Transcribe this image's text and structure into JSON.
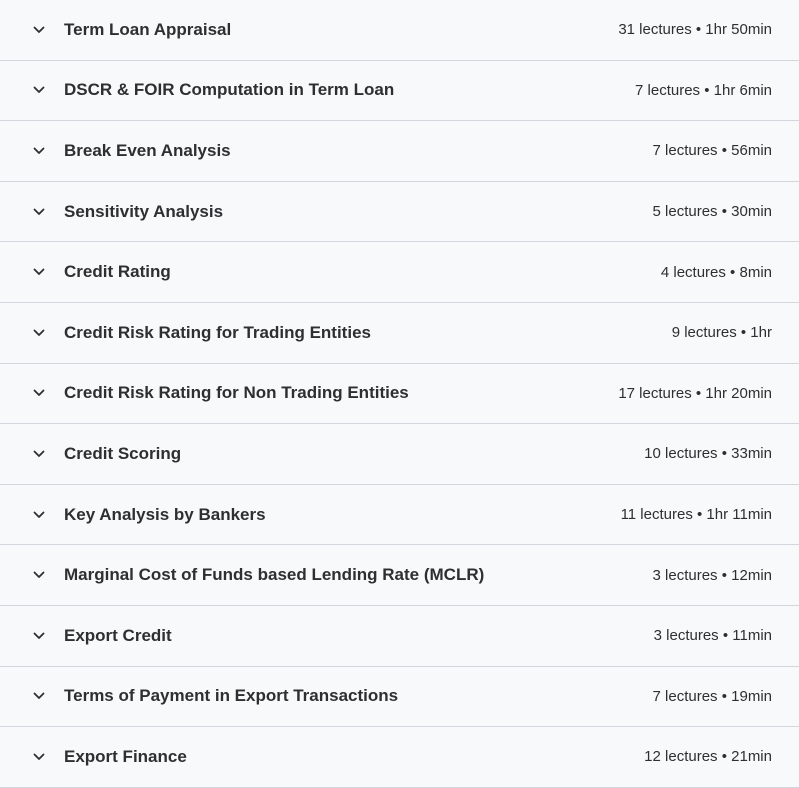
{
  "sections": [
    {
      "title": "Term Loan Appraisal",
      "meta": "31 lectures • 1hr 50min",
      "icon": "chevron-down-icon"
    },
    {
      "title": "DSCR & FOIR Computation in Term Loan",
      "meta": "7 lectures • 1hr 6min",
      "icon": "chevron-down-icon"
    },
    {
      "title": "Break Even Analysis",
      "meta": "7 lectures • 56min",
      "icon": "chevron-down-icon"
    },
    {
      "title": "Sensitivity Analysis",
      "meta": "5 lectures • 30min",
      "icon": "chevron-down-icon"
    },
    {
      "title": "Credit Rating",
      "meta": "4 lectures • 8min",
      "icon": "chevron-down-icon"
    },
    {
      "title": "Credit Risk Rating for Trading Entities",
      "meta": "9 lectures • 1hr",
      "icon": "chevron-down-icon"
    },
    {
      "title": "Credit Risk Rating for Non Trading Entities",
      "meta": "17 lectures • 1hr 20min",
      "icon": "chevron-down-icon"
    },
    {
      "title": "Credit Scoring",
      "meta": "10 lectures • 33min",
      "icon": "chevron-down-icon"
    },
    {
      "title": "Key Analysis by Bankers",
      "meta": "11 lectures • 1hr 11min",
      "icon": "chevron-down-icon"
    },
    {
      "title": "Marginal Cost of Funds based Lending Rate (MCLR)",
      "meta": "3 lectures • 12min",
      "icon": "chevron-down-icon"
    },
    {
      "title": "Export Credit",
      "meta": "3 lectures • 11min",
      "icon": "chevron-down-icon"
    },
    {
      "title": "Terms of Payment in Export Transactions",
      "meta": "7 lectures • 19min",
      "icon": "chevron-down-icon"
    },
    {
      "title": "Export Finance",
      "meta": "12 lectures • 21min",
      "icon": "chevron-down-icon"
    }
  ]
}
